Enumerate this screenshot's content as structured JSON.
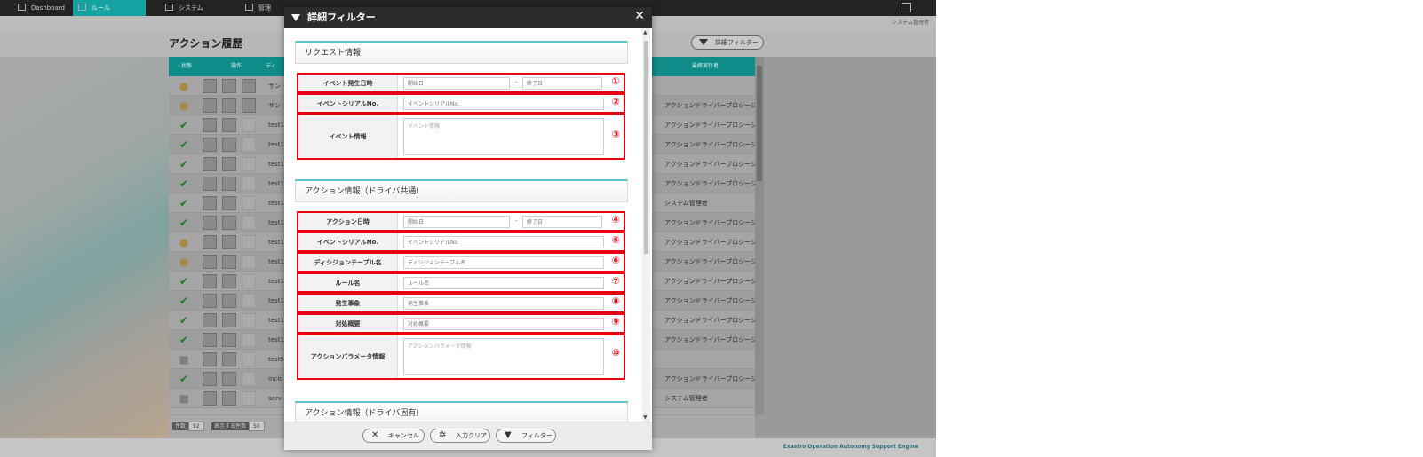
{
  "nav": {
    "tabs": [
      {
        "label": "Dashboard",
        "icon": "dashboard-icon"
      },
      {
        "label": "ルール",
        "icon": "rule-icon",
        "active": true
      },
      {
        "label": "システム",
        "icon": "system-icon"
      },
      {
        "label": "管理",
        "icon": "admin-icon"
      }
    ],
    "user": "システム管理者"
  },
  "page": {
    "title": "アクション履歴",
    "detail_filter_label": "詳細フィルター"
  },
  "table": {
    "headers": [
      "状態",
      "操作",
      "ディ",
      "最終実行者"
    ],
    "rows": [
      {
        "status": "pending",
        "name": "サン",
        "executor": ""
      },
      {
        "status": "pending",
        "name": "サン",
        "executor": "アクションドライバープロシージャ"
      },
      {
        "status": "ok",
        "name": "test1",
        "executor": "アクションドライバープロシージャ"
      },
      {
        "status": "ok",
        "name": "test1",
        "executor": "アクションドライバープロシージャ"
      },
      {
        "status": "ok",
        "name": "test1",
        "executor": "アクションドライバープロシージャ"
      },
      {
        "status": "ok",
        "name": "test1",
        "executor": "アクションドライバープロシージャ"
      },
      {
        "status": "ok",
        "name": "test1",
        "executor": "システム管理者"
      },
      {
        "status": "ok",
        "name": "test1",
        "executor": "アクションドライバープロシージャ"
      },
      {
        "status": "pending",
        "name": "test1",
        "executor": "アクションドライバープロシージャ"
      },
      {
        "status": "pending",
        "name": "test1",
        "executor": "アクションドライバープロシージャ"
      },
      {
        "status": "ok",
        "name": "test1",
        "executor": "アクションドライバープロシージャ"
      },
      {
        "status": "ok",
        "name": "test1",
        "executor": "アクションドライバープロシージャ"
      },
      {
        "status": "ok",
        "name": "test1",
        "executor": "アクションドライバープロシージャ"
      },
      {
        "status": "ok",
        "name": "test1",
        "executor": "アクションドライバープロシージャ"
      },
      {
        "status": "none",
        "name": "test5",
        "executor": ""
      },
      {
        "status": "ok",
        "name": "incid",
        "executor": "アクションドライバープロシージャ"
      },
      {
        "status": "none",
        "name": "serv",
        "executor": "システム管理者"
      }
    ],
    "footer": {
      "count_label": "件数",
      "count_value": "92",
      "display_label": "表示する件数",
      "display_value": "50"
    }
  },
  "brand": "Exastro Operation Autonomy Support Engine",
  "modal": {
    "title": "詳細フィルター",
    "sections": [
      {
        "title": "リクエスト情報",
        "fields": [
          {
            "label": "イベント発生日時",
            "type": "daterange",
            "placeholder_from": "開始日",
            "placeholder_to": "終了日",
            "separator": "-",
            "badge": "①"
          },
          {
            "label": "イベントシリアルNo.",
            "type": "text",
            "placeholder": "イベントシリアルNo.",
            "badge": "②"
          },
          {
            "label": "イベント情報",
            "type": "textarea",
            "placeholder": "イベント情報",
            "badge": "③"
          }
        ]
      },
      {
        "title": "アクション情報（ドライバ共通）",
        "fields": [
          {
            "label": "アクション日時",
            "type": "daterange",
            "placeholder_from": "開始日",
            "placeholder_to": "終了日",
            "separator": "-",
            "badge": "④"
          },
          {
            "label": "イベントシリアルNo.",
            "type": "text",
            "placeholder": "イベントシリアルNo.",
            "badge": "⑤"
          },
          {
            "label": "ディシジョンテーブル名",
            "type": "text",
            "placeholder": "ディシジョンテーブル名",
            "badge": "⑥"
          },
          {
            "label": "ルール名",
            "type": "text",
            "placeholder": "ルール名",
            "badge": "⑦"
          },
          {
            "label": "発生事象",
            "type": "text",
            "placeholder": "発生事象",
            "badge": "⑧"
          },
          {
            "label": "対処概要",
            "type": "text",
            "placeholder": "対処概要",
            "badge": "⑨"
          },
          {
            "label": "アクションパラメータ情報",
            "type": "textarea",
            "placeholder": "アクションパラメータ情報",
            "badge": "⑩"
          }
        ]
      },
      {
        "title": "アクション情報（ドライバ固有）",
        "fields": []
      }
    ],
    "buttons": {
      "cancel": "キャンセル",
      "clear": "入力クリア",
      "filter": "フィルター"
    }
  },
  "colors": {
    "accent": "#14a3a0",
    "highlight": "#e60012",
    "header": "#2c2c2c"
  }
}
